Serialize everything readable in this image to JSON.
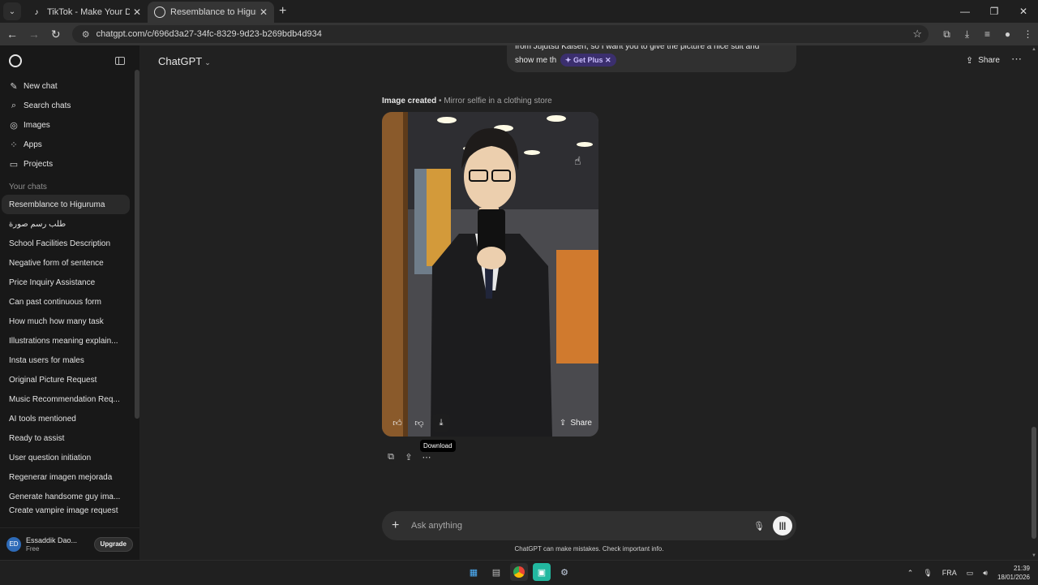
{
  "browser": {
    "tabs": [
      {
        "title": "TikTok - Make Your Day",
        "active": false
      },
      {
        "title": "Resemblance to Higuruma",
        "active": true
      }
    ],
    "url": "chatgpt.com/c/696d3a27-34fc-8329-9d23-b269bdb4d934"
  },
  "sidebar": {
    "nav": [
      {
        "label": "New chat",
        "icon": "edit-icon"
      },
      {
        "label": "Search chats",
        "icon": "search-icon"
      },
      {
        "label": "Images",
        "icon": "images-icon"
      },
      {
        "label": "Apps",
        "icon": "apps-icon"
      },
      {
        "label": "Projects",
        "icon": "folder-icon"
      }
    ],
    "section_title": "Your chats",
    "chats": [
      "Resemblance to Higuruma",
      "طلب رسم صورة",
      "School Facilities Description",
      "Negative form of sentence",
      "Price Inquiry Assistance",
      "Can past continuous form",
      "How much how many task",
      "Illustrations meaning explain...",
      "Insta users for males",
      "Original Picture Request",
      "Music Recommendation Req...",
      "AI tools mentioned",
      "Ready to assist",
      "User question initiation",
      "Regenerar imagen mejorada",
      "Generate handsome guy ima...",
      "Create vampire image request"
    ],
    "user": {
      "initials": "ED",
      "name": "Essaddik Dao...",
      "plan": "Free",
      "upgrade_label": "Upgrade"
    }
  },
  "main": {
    "title": "ChatGPT",
    "share_label": "Share",
    "user_message_line1": "from Jujutsu Kaisen, so I want you to give the picture a nice suit and",
    "user_message_line2": "show me th",
    "get_plus_label": "Get Plus",
    "image_created_label": "Image created",
    "image_caption": "• Mirror selfie in a clothing store",
    "image_share_label": "Share",
    "tooltip": "Download",
    "composer_placeholder": "Ask anything",
    "disclaimer": "ChatGPT can make mistakes. Check important info."
  },
  "taskbar": {
    "lang": "FRA",
    "time": "21:39",
    "date": "18/01/2026"
  }
}
